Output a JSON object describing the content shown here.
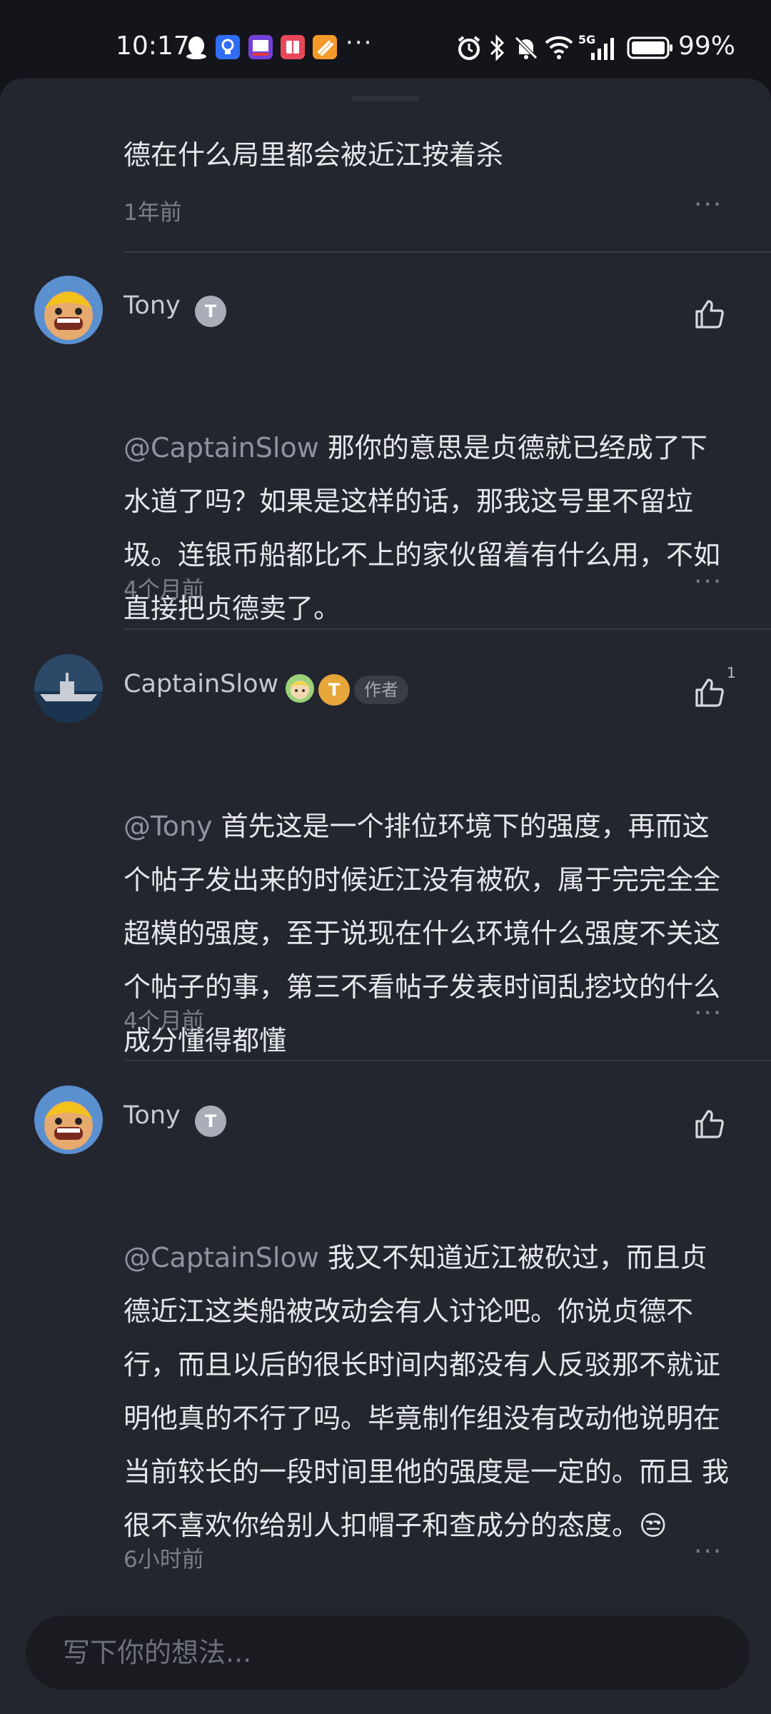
{
  "status_bar": {
    "time": "10:17",
    "overflow": "···",
    "network": "5G",
    "battery": "99%"
  },
  "comments": [
    {
      "text": "德在什么局里都会被近江按着杀",
      "time": "1年前"
    },
    {
      "user": "Tony",
      "badge": "T",
      "mention": "@CaptainSlow",
      "text": " 那你的意思是贞德就已经成了下水道了吗？如果是这样的话，那我这号里不留垃圾。连银币船都比不上的家伙留着有什么用，不如直接把贞德卖了。",
      "time": "4个月前"
    },
    {
      "user": "CaptainSlow",
      "badge": "T",
      "author_tag": "作者",
      "likes": "1",
      "mention": "@Tony",
      "text": " 首先这是一个排位环境下的强度，再而这个帖子发出来的时候近江没有被砍，属于完完全全超模的强度，至于说现在什么环境什么强度不关这个帖子的事，第三不看帖子发表时间乱挖坟的什么成分懂得都懂",
      "time": "4个月前"
    },
    {
      "user": "Tony",
      "badge": "T",
      "mention": "@CaptainSlow",
      "text": " 我又不知道近江被砍过，而且贞德近江这类船被改动会有人讨论吧。你说贞德不行，而且以后的很长时间内都没有人反驳那不就证明他真的不行了吗。毕竟制作组没有改动他说明在当前较长的一段时间里他的强度是一定的。而且 我很不喜欢你给别人扣帽子和查成分的态度。😒",
      "time": "6小时前"
    }
  ],
  "more_label": "···",
  "input": {
    "placeholder": "写下你的想法..."
  },
  "icons": {
    "like": "thumbs-up-icon",
    "more": "more-dots-icon"
  },
  "colors": {
    "background": "#24262f",
    "status_bar": "#14151b",
    "text": "#e6e7ea",
    "muted": "#7d7f88",
    "badge_silver": "#a9aeb8",
    "badge_gold": "#e7a63a"
  }
}
